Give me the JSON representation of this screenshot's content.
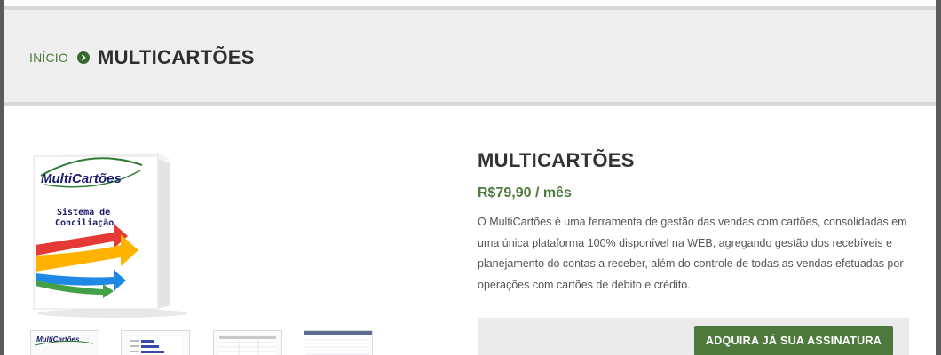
{
  "breadcrumb": {
    "home_label": "INÍCIO",
    "current_label": "MULTICARTÕES"
  },
  "product": {
    "title": "MULTICARTÕES",
    "price": "R$79,90 / mês",
    "description": "O MultiCartões é uma ferramenta de gestão das vendas com cartões, consolidadas em uma única plataforma 100% disponível na WEB, agregando gestão dos recebíveis e planejamento do contas a receber, além do controle de todas as vendas efetuadas por operações com cartões de débito e crédito.",
    "image": {
      "brand": "MultiCartões",
      "subtitle_line1": "Sistema de",
      "subtitle_line2": "Conciliação"
    },
    "thumbnails": [
      "product-box",
      "bar-chart-report",
      "data-table-report",
      "spreadsheet-report"
    ]
  },
  "cta": {
    "label": "ADQUIRA JÁ SUA ASSINATURA"
  },
  "colors": {
    "accent": "#4d7a3c",
    "dark_green": "#356b2d",
    "text": "#333333",
    "panel": "#ebebeb"
  }
}
